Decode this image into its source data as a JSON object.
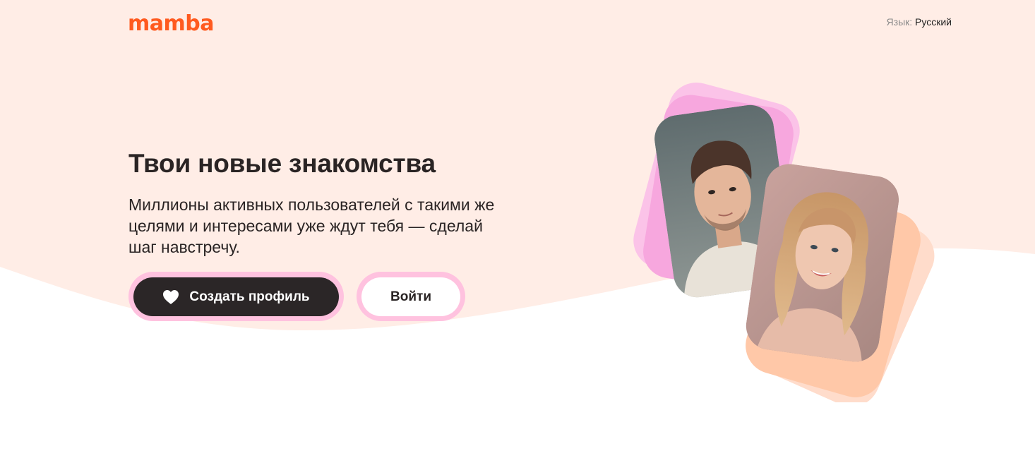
{
  "header": {
    "logo_text": "mamba",
    "language_label": "Язык:",
    "language_value": "Русский"
  },
  "hero": {
    "title": "Твои новые знакомства",
    "subtitle": "Миллионы активных пользователей с такими же целями и интересами уже ждут тебя — сделай шаг навстречу.",
    "create_button_label": "Создать профиль",
    "login_button_label": "Войти"
  },
  "photos": [
    {
      "name": "man-photo"
    },
    {
      "name": "woman-photo"
    }
  ],
  "colors": {
    "brand": "#ff5a1f",
    "background_top": "#ffede6",
    "primary_button": "#2b2627",
    "button_ring": "#ffc2df",
    "card_pink": "#f9a6d9",
    "card_peach": "#ffc9a8"
  },
  "icons": {
    "heart": "heart-icon"
  }
}
